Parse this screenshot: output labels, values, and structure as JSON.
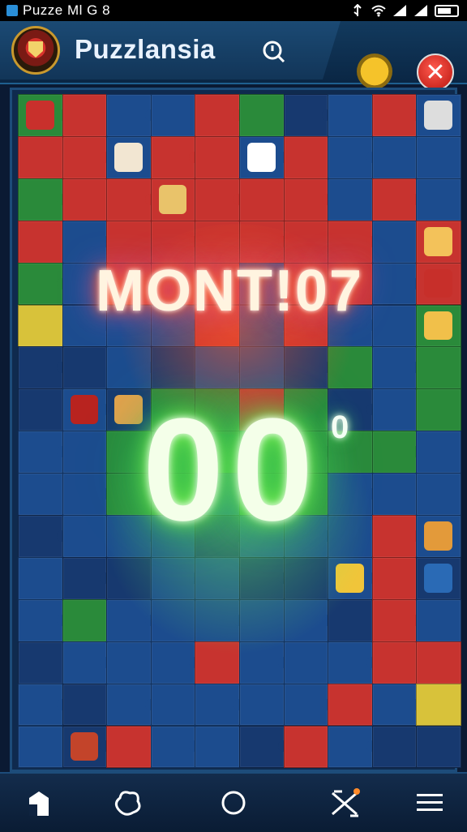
{
  "status_bar": {
    "app_title": "Puzze Ml G 8",
    "icons": [
      "usb-icon",
      "wifi-icon",
      "signal-icon",
      "signal-icon",
      "battery-icon"
    ]
  },
  "header": {
    "title": "Puzzlansia",
    "logo_icon": "crest-icon",
    "search_icon": "search-icon",
    "trophy_icon": "trophy-icon",
    "close_icon": "close-icon"
  },
  "board": {
    "banner_text": "MONT!07",
    "big_number": "00",
    "small_number": "0"
  },
  "bottom_nav": {
    "items": [
      {
        "icon": "home-icon"
      },
      {
        "icon": "shape-icon"
      },
      {
        "icon": "circle-icon"
      },
      {
        "icon": "shuffle-icon"
      },
      {
        "icon": "menu-icon"
      }
    ]
  },
  "colors": {
    "tile_blue": "#1c4c8e",
    "tile_dark_blue": "#17396f",
    "tile_red": "#c7332f",
    "tile_green": "#2a8a3a",
    "tile_yellow": "#d8c23a",
    "glow_green": "#3dd62a",
    "glow_orange": "#ff7a3a"
  }
}
